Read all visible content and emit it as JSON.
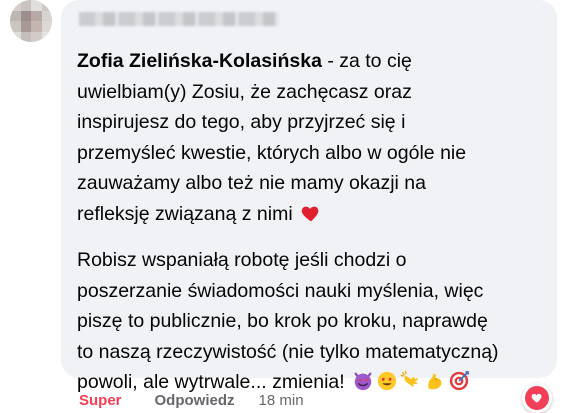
{
  "comment": {
    "author": "Zofia Zielińska-Kolasińska",
    "paragraph1_lines": [
      " - za to cię",
      "uwielbiam(y) Zosiu, że zachęcasz oraz",
      "inspirujesz do tego, aby przyjrzeć się i",
      "przemyśleć kwestie, których albo w ogóle nie",
      "zauważamy albo też nie mamy okazji na",
      "refleksję związaną z nimi"
    ],
    "paragraph2_lines": [
      "Robisz wspaniałą robotę jeśli chodzi o",
      "poszerzanie świadomości nauki myślenia, więc",
      "piszę to publicznie, bo krok po kroku, naprawdę",
      "to naszą rzeczywistość (nie tylko matematyczną)",
      "powoli, ale wytrwale... zmienia!"
    ],
    "emojis": {
      "heart": "red-heart-icon",
      "trailing": [
        "smiling-face-with-horns-heart-eyes-icon",
        "heart-eyes-icon",
        "clapping-hands-icon",
        "flexed-biceps-icon",
        "direct-hit-icon"
      ]
    }
  },
  "footer": {
    "reaction_label": "Super",
    "reply_label": "Odpowiedz",
    "time_label": "18 min"
  },
  "reaction_badge": {
    "icon": "love-reaction-icon",
    "color": "#f33e58"
  },
  "colors": {
    "bubble_bg": "#f0f2f5",
    "text": "#050505",
    "secondary": "#65676b",
    "love": "#f33e58"
  }
}
